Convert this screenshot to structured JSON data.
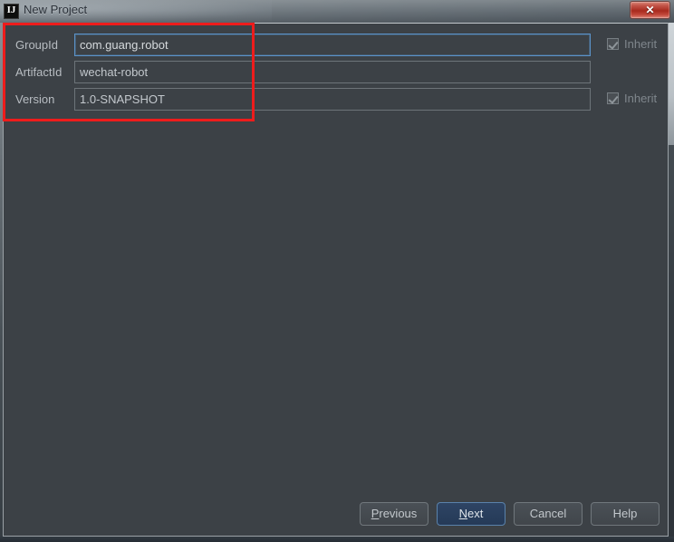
{
  "window": {
    "title": "New Project",
    "app_icon_text": "IJ",
    "close_label": "✕"
  },
  "form": {
    "rows": [
      {
        "label": "GroupId",
        "value": "com.guang.robot",
        "placeholder": "",
        "focused": true,
        "inherit": {
          "label": "Inherit",
          "checked": true,
          "visible": true
        }
      },
      {
        "label": "ArtifactId",
        "value": "wechat-robot",
        "placeholder": "",
        "focused": false,
        "inherit": {
          "label": "",
          "checked": false,
          "visible": false
        }
      },
      {
        "label": "Version",
        "value": "1.0-SNAPSHOT",
        "placeholder": "",
        "focused": false,
        "inherit": {
          "label": "Inherit",
          "checked": true,
          "visible": true
        }
      }
    ]
  },
  "footer": {
    "previous": {
      "prefix": "",
      "mnemonic": "P",
      "suffix": "revious"
    },
    "next": {
      "prefix": "",
      "mnemonic": "N",
      "suffix": "ext"
    },
    "cancel": {
      "prefix": "Cancel",
      "mnemonic": "",
      "suffix": ""
    },
    "help": {
      "prefix": "Help",
      "mnemonic": "",
      "suffix": ""
    }
  },
  "annotation": {
    "color": "#ee1c1c"
  },
  "colors": {
    "dialog_background": "#3c4146",
    "field_border": "#6d7479",
    "field_focus_border": "#5b93c9",
    "default_button": "#2e4464",
    "text": "#b8bdc2"
  }
}
